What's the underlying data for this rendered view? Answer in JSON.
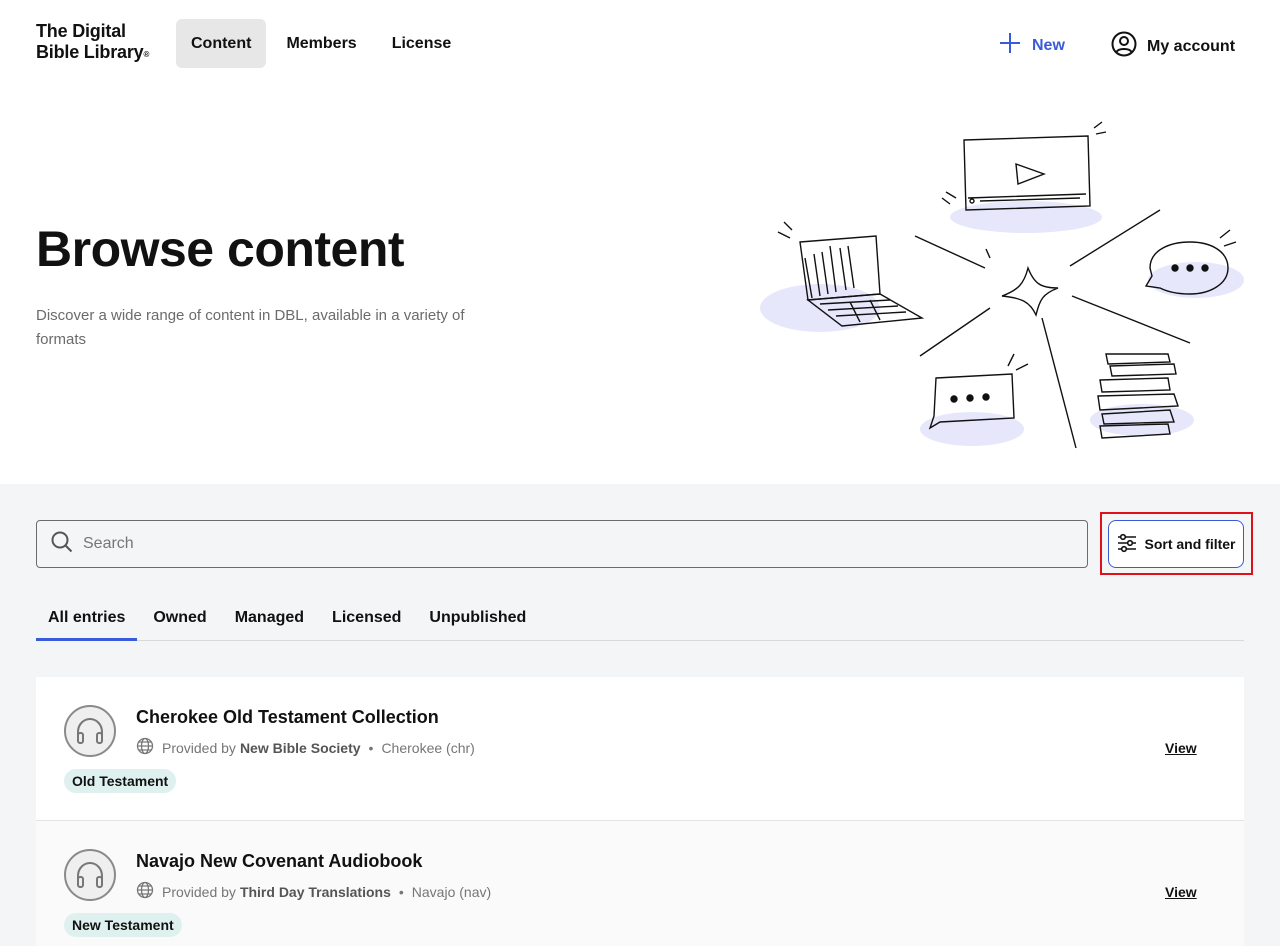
{
  "header": {
    "logo_line1": "The Digital",
    "logo_line2": "Bible Library",
    "logo_mark": "®",
    "nav": [
      {
        "label": "Content",
        "active": true
      },
      {
        "label": "Members",
        "active": false
      },
      {
        "label": "License",
        "active": false
      }
    ],
    "new_label": "New",
    "account_label": "My account",
    "accent_color": "#3a5bd9"
  },
  "hero": {
    "title": "Browse content",
    "subtitle": "Discover a wide range of content in DBL, available in a variety of formats"
  },
  "search": {
    "placeholder": "Search",
    "value": ""
  },
  "sort_filter_label": "Sort and filter",
  "tabs": [
    {
      "label": "All entries",
      "active": true
    },
    {
      "label": "Owned",
      "active": false
    },
    {
      "label": "Managed",
      "active": false
    },
    {
      "label": "Licensed",
      "active": false
    },
    {
      "label": "Unpublished",
      "active": false
    }
  ],
  "entries": [
    {
      "icon": "headphones-icon",
      "title": "Cherokee Old Testament Collection",
      "provided_by_prefix": "Provided by",
      "provider": "New Bible Society",
      "separator": "•",
      "language": "Cherokee (chr)",
      "badge": "Old Testament",
      "view_label": "View"
    },
    {
      "icon": "headphones-icon",
      "title": "Navajo New Covenant Audiobook",
      "provided_by_prefix": "Provided by",
      "provider": "Third Day Translations",
      "separator": "•",
      "language": "Navajo (nav)",
      "badge": "New Testament",
      "view_label": "View"
    }
  ]
}
